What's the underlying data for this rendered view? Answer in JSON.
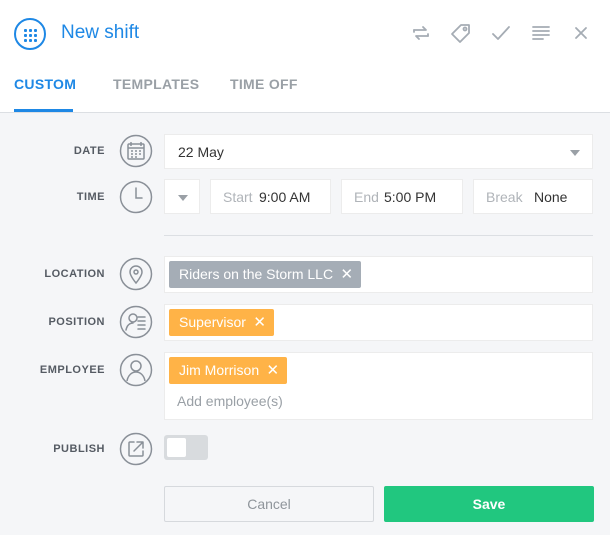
{
  "header": {
    "title": "New shift",
    "actions": [
      "repeat-icon",
      "tag-icon",
      "check-icon",
      "notes-icon",
      "close-icon"
    ],
    "accent_color": "#1e88e5"
  },
  "tabs": [
    {
      "label": "CUSTOM",
      "active": true
    },
    {
      "label": "TEMPLATES",
      "active": false
    },
    {
      "label": "TIME OFF",
      "active": false
    }
  ],
  "form": {
    "date": {
      "label": "DATE",
      "value": "22 May"
    },
    "time": {
      "label": "TIME",
      "start_label": "Start",
      "start_value": "9:00 AM",
      "end_label": "End",
      "end_value": "5:00 PM",
      "break_label": "Break",
      "break_value": "None"
    },
    "location": {
      "label": "LOCATION",
      "tag": "Riders on the Storm LLC",
      "tag_color": "#a5adb6"
    },
    "position": {
      "label": "POSITION",
      "tag": "Supervisor",
      "tag_color": "#ffb347"
    },
    "employee": {
      "label": "EMPLOYEE",
      "tag": "Jim Morrison",
      "tag_color": "#ffb347",
      "placeholder": "Add employee(s)"
    },
    "publish": {
      "label": "PUBLISH",
      "enabled": false
    }
  },
  "buttons": {
    "cancel": "Cancel",
    "save": "Save",
    "save_color": "#21c77f"
  }
}
